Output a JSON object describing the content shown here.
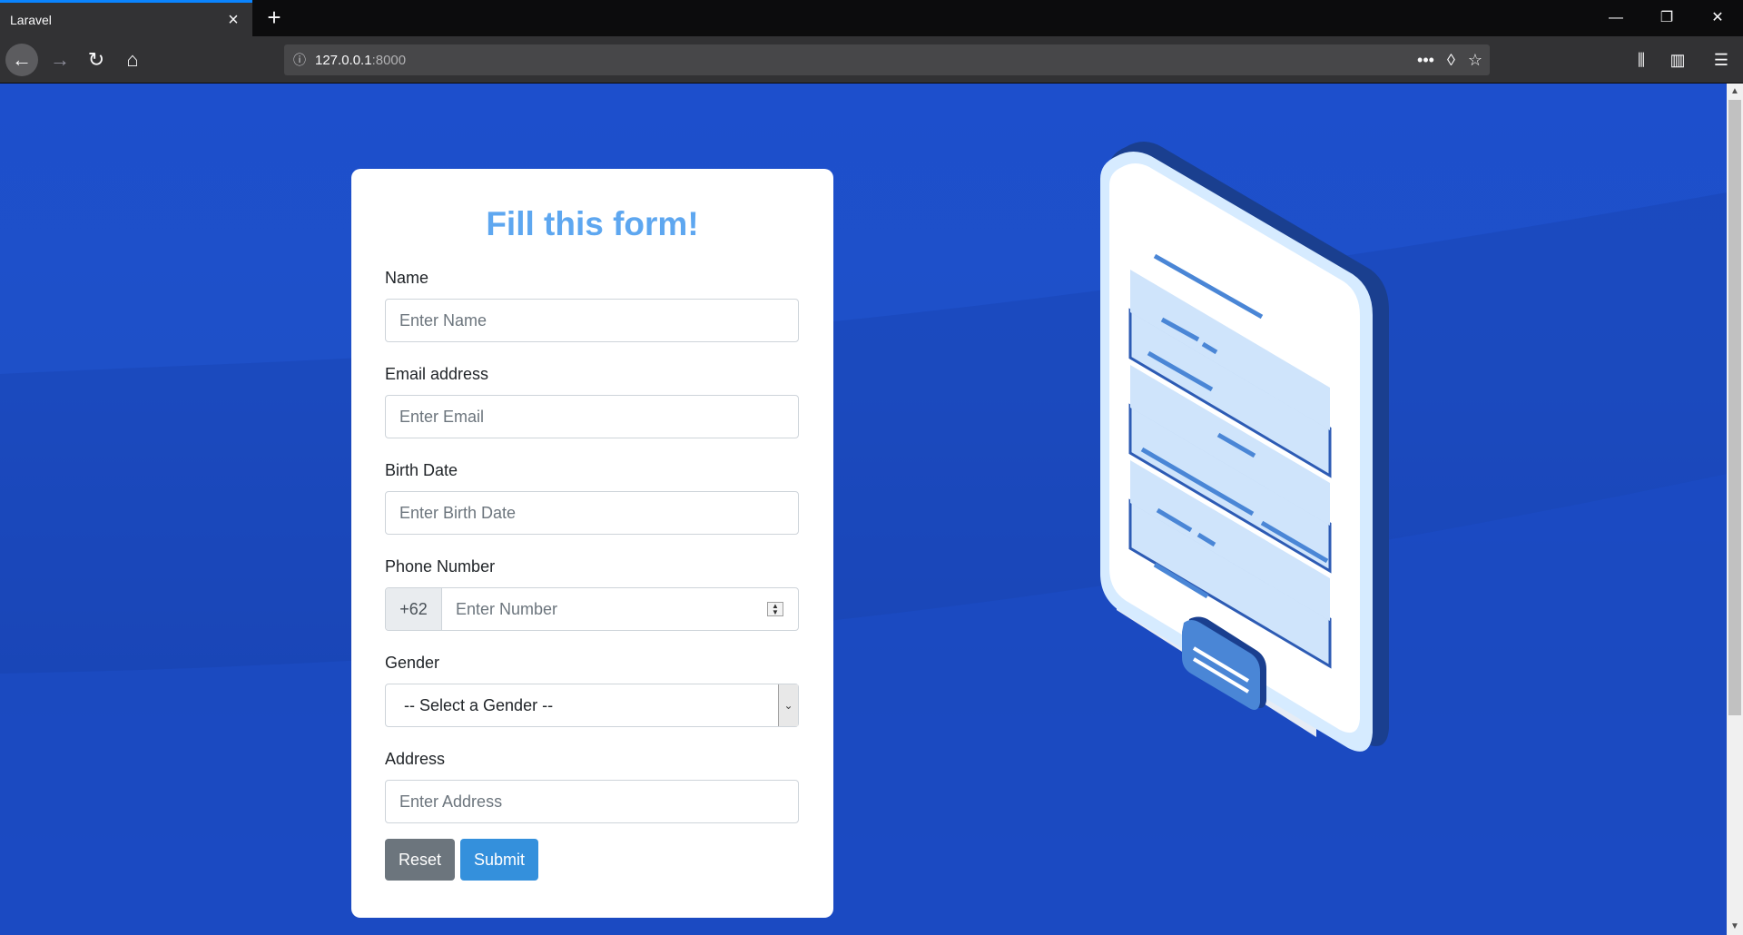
{
  "browser": {
    "tab_title": "Laravel",
    "url_host": "127.0.0.1",
    "url_port": ":8000"
  },
  "form": {
    "title": "Fill this form!",
    "name": {
      "label": "Name",
      "placeholder": "Enter Name"
    },
    "email": {
      "label": "Email address",
      "placeholder": "Enter Email"
    },
    "birth": {
      "label": "Birth Date",
      "placeholder": "Enter Birth Date"
    },
    "phone": {
      "label": "Phone Number",
      "prefix": "+62",
      "placeholder": "Enter Number"
    },
    "gender": {
      "label": "Gender",
      "selected": "-- Select a Gender --"
    },
    "address": {
      "label": "Address",
      "placeholder": "Enter Address"
    },
    "reset_label": "Reset",
    "submit_label": "Submit"
  },
  "colors": {
    "background": "#1d4fcc",
    "title": "#5ea7f0",
    "reset": "#6c757d",
    "submit": "#3490dc"
  }
}
